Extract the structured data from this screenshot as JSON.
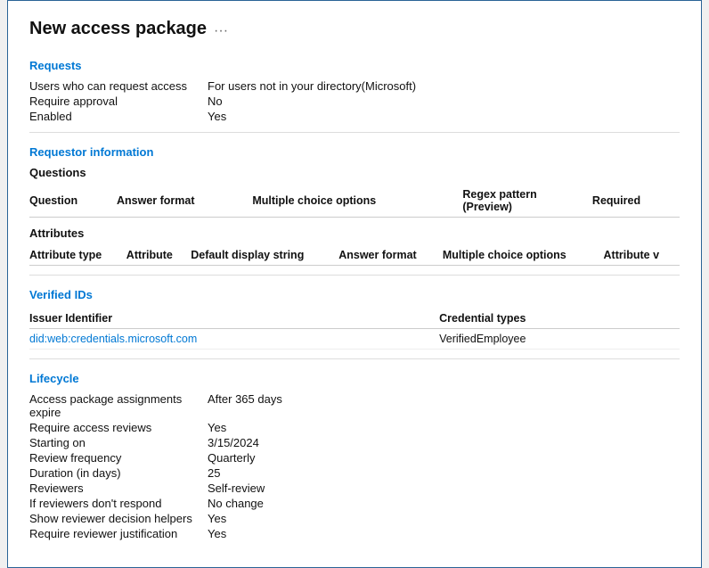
{
  "window": {
    "title": "New access package",
    "menu_icon": "···"
  },
  "sections": {
    "requests": {
      "label": "Requests",
      "fields": [
        {
          "label": "Users who can request access",
          "value": "For users not in your directory(Microsoft)"
        },
        {
          "label": "Require approval",
          "value": "No"
        },
        {
          "label": "Enabled",
          "value": "Yes"
        }
      ]
    },
    "requestor_information": {
      "label": "Requestor information",
      "questions": {
        "title": "Questions",
        "columns": [
          "Question",
          "Answer format",
          "Multiple choice options",
          "Regex pattern (Preview)",
          "Required"
        ],
        "rows": []
      },
      "attributes": {
        "title": "Attributes",
        "columns": [
          "Attribute type",
          "Attribute",
          "Default display string",
          "Answer format",
          "Multiple choice options",
          "Attribute v"
        ],
        "rows": []
      }
    },
    "verified_ids": {
      "label": "Verified IDs",
      "columns": [
        "Issuer Identifier",
        "Credential types"
      ],
      "rows": [
        {
          "issuer": "did:web:credentials.microsoft.com",
          "credential": "VerifiedEmployee"
        }
      ]
    },
    "lifecycle": {
      "label": "Lifecycle",
      "fields": [
        {
          "label": "Access package assignments expire",
          "value": "After 365 days"
        },
        {
          "label": "Require access reviews",
          "value": "Yes"
        },
        {
          "label": "Starting on",
          "value": "3/15/2024"
        },
        {
          "label": "Review frequency",
          "value": "Quarterly"
        },
        {
          "label": "Duration (in days)",
          "value": "25"
        },
        {
          "label": "Reviewers",
          "value": "Self-review"
        },
        {
          "label": "If reviewers don't respond",
          "value": "No change"
        },
        {
          "label": "Show reviewer decision helpers",
          "value": "Yes"
        },
        {
          "label": "Require reviewer justification",
          "value": "Yes"
        }
      ]
    }
  }
}
